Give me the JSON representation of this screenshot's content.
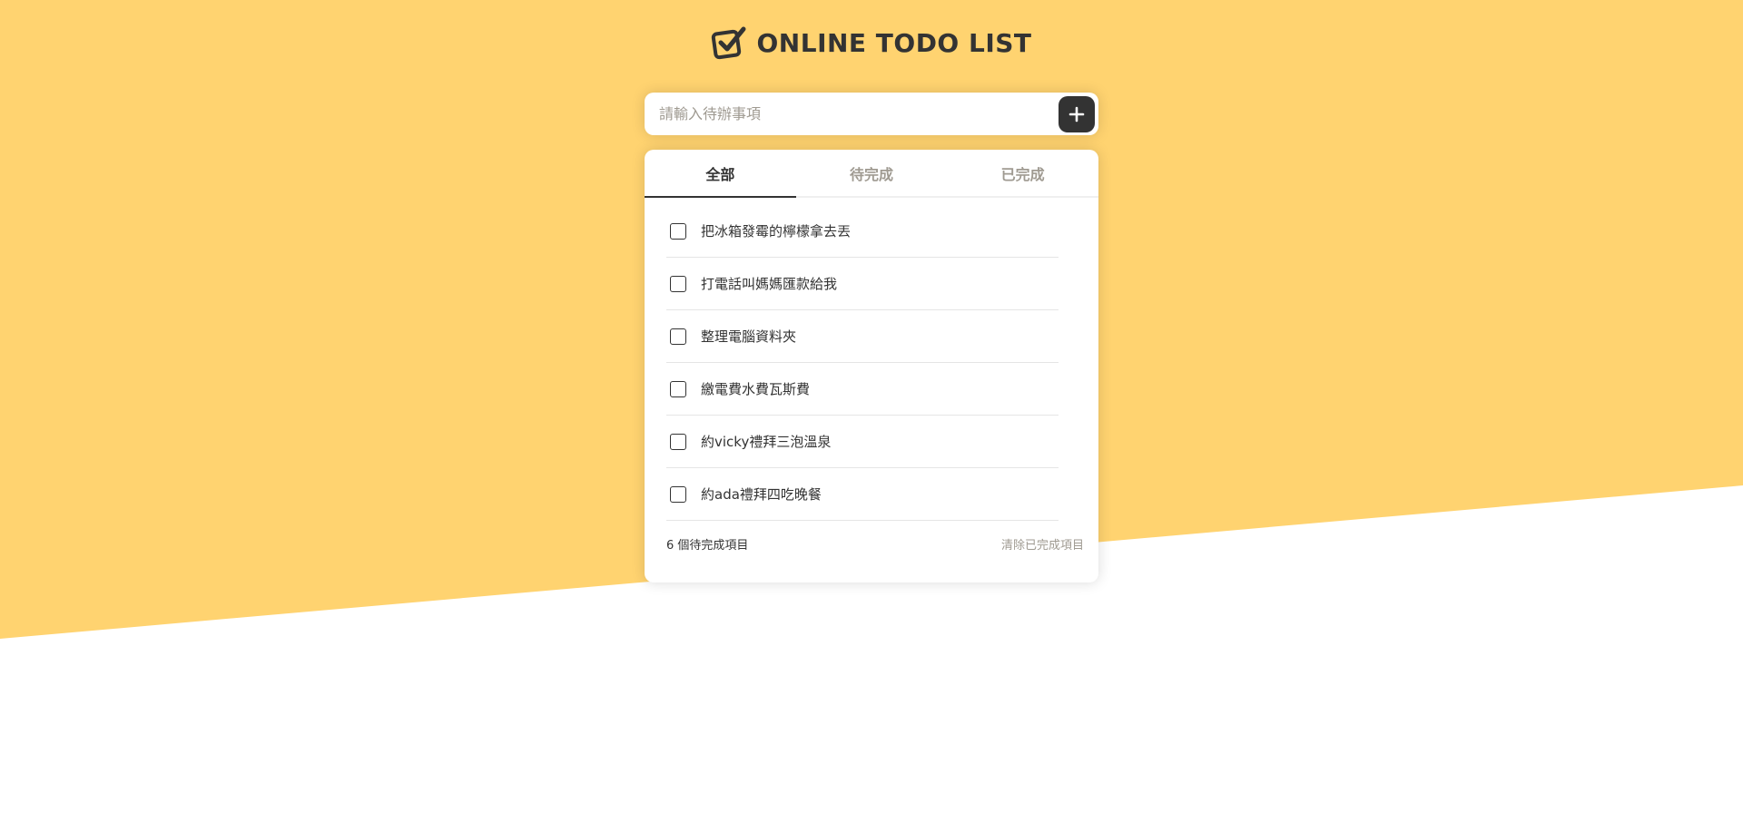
{
  "app": {
    "title": "ONLINE TODO LIST",
    "logo_icon": "checkbox-check-icon"
  },
  "colors": {
    "background_accent": "#FFD370",
    "text": "#333333",
    "muted": "#9F9A91",
    "white": "#FFFFFF"
  },
  "add_bar": {
    "placeholder": "請輸入待辦事項",
    "value": "",
    "button_icon": "plus-icon"
  },
  "tabs": [
    {
      "label": "全部",
      "active": true
    },
    {
      "label": "待完成",
      "active": false
    },
    {
      "label": "已完成",
      "active": false
    }
  ],
  "todos": [
    {
      "text": "把冰箱發霉的檸檬拿去丟",
      "done": false
    },
    {
      "text": "打電話叫媽媽匯款給我",
      "done": false
    },
    {
      "text": "整理電腦資料夾",
      "done": false
    },
    {
      "text": "繳電費水費瓦斯費",
      "done": false
    },
    {
      "text": "約vicky禮拜三泡溫泉",
      "done": false
    },
    {
      "text": "約ada禮拜四吃晚餐",
      "done": false
    }
  ],
  "footer": {
    "pending_label": "6 個待完成項目",
    "clear_label": "清除已完成項目"
  }
}
